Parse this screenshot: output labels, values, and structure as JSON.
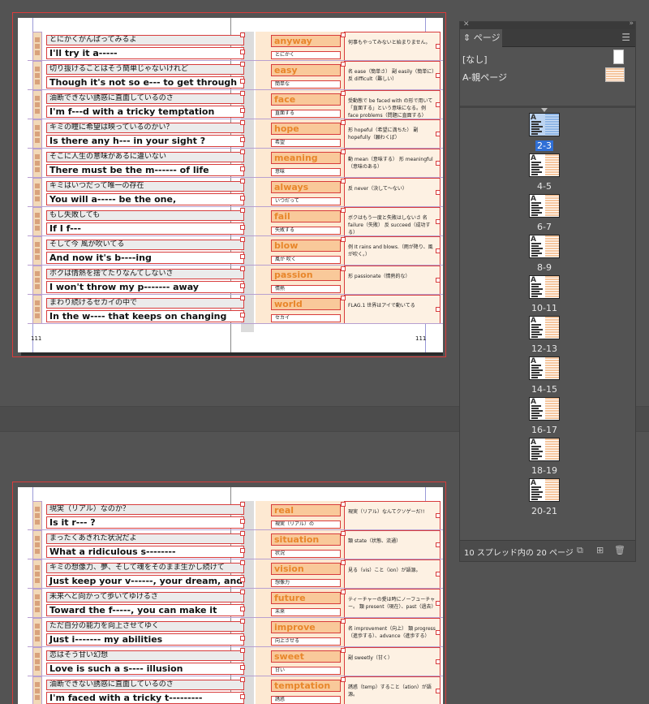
{
  "spread1": {
    "folio_left": "111",
    "folio_right": "111",
    "rows": [
      {
        "ja": "とにかくがんばってみるよ",
        "en": "I'll try it a-----",
        "word": "anyway",
        "word_ja": "とにかく",
        "def": "何事もやってみないと始まりません。"
      },
      {
        "ja": "切り抜けることはそう簡単じゃないけれど",
        "en": "Though it's not so e--- to get through",
        "word": "easy",
        "word_ja": "簡単な",
        "def": "名 ease（簡単さ） 副 easily（簡単に） 反 difficult（難しい）"
      },
      {
        "ja": "油断できない誘惑に直面しているのさ",
        "en": "I'm f---d with a tricky temptation",
        "word": "face",
        "word_ja": "直面する",
        "def": "受動態で be faced with の形で用いて「直面する」という意味になる。例 face problems（問題に直面する）"
      },
      {
        "ja": "キミの瞳に希望は映っているのかい？",
        "en": "Is there any h--- in your sight ?",
        "word": "hope",
        "word_ja": "希望",
        "def": "形 hopeful（希望に満ちた） 副 hopefully（願わくば）"
      },
      {
        "ja": "そこに人生の意味があるに違いない",
        "en": "There must be the m------ of life",
        "word": "meaning",
        "word_ja": "意味",
        "def": "動 mean（意味する） 形 meaningful（意味のある）"
      },
      {
        "ja": "キミはいつだって唯一の存在",
        "en": "You will a----- be the one,",
        "word": "always",
        "word_ja": "いつだって",
        "def": "反 never（決して～ない）"
      },
      {
        "ja": "もし失敗しても",
        "en": "If I f---",
        "word": "fail",
        "word_ja": "失敗する",
        "def": "ボクはもう一度と失敗はしないさ 名 failure（失敗） 反 succeed（成功する）"
      },
      {
        "ja": "そして今 風が吹いてる",
        "en": "And now it's b----ing",
        "word": "blow",
        "word_ja": "風が 吹く",
        "def": "例 It rains and blows.（雨が降り、風が吹く。）"
      },
      {
        "ja": "ボクは情熱を捨てたりなんてしないさ",
        "en": "I won't throw my p------- away",
        "word": "passion",
        "word_ja": "情熱",
        "def": "形 passionate（情熱的な）"
      },
      {
        "ja": "まわり続けるセカイの中で",
        "en": "In the w---- that keeps on changing",
        "word": "world",
        "word_ja": "セカイ",
        "def": "FLAG.1 世界はアイで動いてる"
      }
    ]
  },
  "spread2": {
    "rows": [
      {
        "ja": "現実（リアル）なのか？",
        "en": "Is it r--- ?",
        "word": "real",
        "word_ja": "現実（リアル）の",
        "def": "現実（リアル）なんてクソゲーだ!!"
      },
      {
        "ja": "まったくあきれた状況だよ",
        "en": "What a ridiculous s--------",
        "word": "situation",
        "word_ja": "状況",
        "def": "類 state（状態、流通）"
      },
      {
        "ja": "キミの想像力、夢、そして魂をそのまま生かし続けて",
        "en": "Just keep your v------, your dream, and",
        "word": "vision",
        "word_ja": "想像力",
        "def": "見る（vis）こと（ion）が語源。"
      },
      {
        "ja": "未来へと向かって歩いてゆけるさ",
        "en": "Toward the f-----, you can make it",
        "word": "future",
        "word_ja": "未来",
        "def": "ティーチャーの愛は時にノーフューチャー。 類 present（現在）、past（過去）"
      },
      {
        "ja": "ただ自分の能力を向上させてゆく",
        "en": "Just i------- my abilities",
        "word": "improve",
        "word_ja": "向上させる",
        "def": "名 improvement（向上） 類 progress（進歩する）、advance（進歩する）"
      },
      {
        "ja": "恋はそう甘い幻想",
        "en": "Love is such a s---- illusion",
        "word": "sweet",
        "word_ja": "甘い",
        "def": "副 sweetly（甘く）"
      },
      {
        "ja": "油断できない誘惑に直面しているのさ",
        "en": "I'm faced with a tricky t---------",
        "word": "temptation",
        "word_ja": "誘惑",
        "def": "誘惑（temp）すること（ation）が語源。"
      }
    ]
  },
  "panel": {
    "title": "ページ",
    "master_none": "[なし]",
    "master_a": "A-親ページ",
    "spreads": [
      "2-3",
      "4-5",
      "6-7",
      "8-9",
      "10-11",
      "12-13",
      "14-15",
      "16-17",
      "18-19",
      "20-21"
    ],
    "selected_index": 0,
    "footer": "10 スプレッド内の 20 ページ"
  }
}
